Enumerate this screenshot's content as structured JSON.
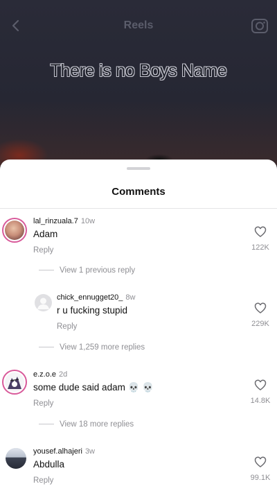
{
  "header": {
    "title": "Reels",
    "back_icon": "chevron-left-icon",
    "camera_icon": "camera-icon"
  },
  "reel": {
    "caption": "There is no Boys Name"
  },
  "sheet": {
    "title": "Comments"
  },
  "comments": [
    {
      "username": "lal_rinzuala.7",
      "time": "10w",
      "text": "Adam",
      "reply_label": "Reply",
      "likes": "122K",
      "view_more": "View 1 previous reply"
    },
    {
      "username": "chick_ennugget20_",
      "time": "8w",
      "text": "r u fucking stupid",
      "reply_label": "Reply",
      "likes": "229K",
      "view_more": "View 1,259 more replies"
    },
    {
      "username": "e.z.o.e",
      "time": "2d",
      "text": "some dude said adam 💀 💀",
      "reply_label": "Reply",
      "likes": "14.8K",
      "view_more": "View 18 more replies"
    },
    {
      "username": "yousef.alhajeri",
      "time": "3w",
      "text": "Abdulla",
      "reply_label": "Reply",
      "likes": "99.1K"
    }
  ],
  "colors": {
    "sheet_bg": "#ffffff",
    "muted": "#8e8e93",
    "story_ring": "#d85a9a"
  }
}
